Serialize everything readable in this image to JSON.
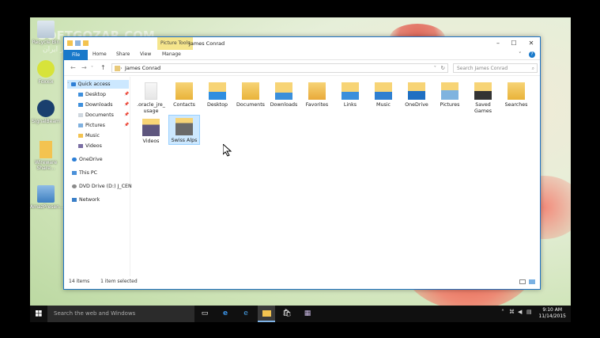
{
  "watermark": {
    "line1": "SOFTGOZAR.COM",
    "line2": "سافت گذر ایران"
  },
  "desktop_icons": [
    {
      "label": "Recycle Bin",
      "icon": "recycle-bin-icon"
    },
    {
      "label": "Foxxix",
      "icon": "smiley-app-icon"
    },
    {
      "label": "SignalBeam",
      "icon": "wifi-app-icon"
    },
    {
      "label": "Wireware Share...",
      "icon": "folder-shortcut-icon"
    },
    {
      "label": "AmazPresen...",
      "icon": "presentation-app-icon"
    }
  ],
  "window": {
    "context_tab": "Picture Tools",
    "title": "James Conrad",
    "ribbon_tabs": {
      "file": "File",
      "home": "Home",
      "share": "Share",
      "view": "View",
      "manage": "Manage"
    },
    "address": "James Conrad",
    "search_placeholder": "Search James Conrad",
    "nav": {
      "quick_access": "Quick access",
      "desktop": "Desktop",
      "downloads": "Downloads",
      "documents": "Documents",
      "pictures": "Pictures",
      "music": "Music",
      "videos": "Videos",
      "onedrive": "OneDrive",
      "this_pc": "This PC",
      "dvd": "DVD Drive (D:) J_CEN",
      "network": "Network"
    },
    "items": [
      ".oracle_jre_ usage",
      "Contacts",
      "Desktop",
      "Documents",
      "Downloads",
      "Favorites",
      "Links",
      "Music",
      "OneDrive",
      "Pictures",
      "Saved Games",
      "Searches",
      "Videos",
      "Swiss Alps"
    ],
    "status": {
      "count": "14 items",
      "selected": "1 item selected"
    }
  },
  "taskbar": {
    "search_placeholder": "Search the web and Windows",
    "time": "9:10 AM",
    "date": "11/14/2015"
  },
  "colors": {
    "accent": "#1979ca",
    "folder": "#f3c350",
    "selection": "#cce8ff"
  }
}
